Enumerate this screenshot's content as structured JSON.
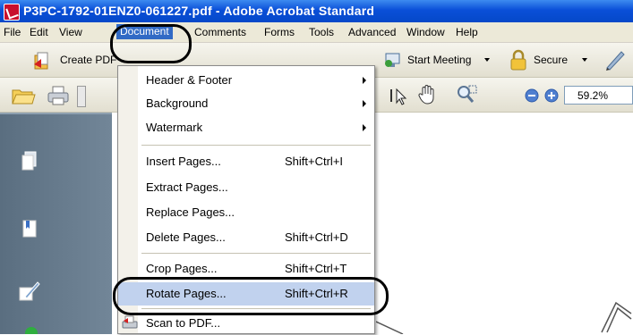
{
  "window": {
    "title": "P3PC-1792-01ENZ0-061227.pdf - Adobe Acrobat Standard"
  },
  "menubar": {
    "items": [
      "File",
      "Edit",
      "View",
      "Document",
      "Comments",
      "Forms",
      "Tools",
      "Advanced",
      "Window",
      "Help"
    ],
    "active": "Document"
  },
  "toolbar": {
    "create_pdf": "Create PDF",
    "start_meeting": "Start Meeting",
    "secure": "Secure",
    "zoom": "59.2%"
  },
  "document_menu": {
    "items": [
      {
        "label": "Header & Footer",
        "shortcut": "",
        "submenu": true
      },
      {
        "label": "Background",
        "shortcut": "",
        "submenu": true
      },
      {
        "label": "Watermark",
        "shortcut": "",
        "submenu": true
      },
      {
        "label": "Insert Pages...",
        "shortcut": "Shift+Ctrl+I"
      },
      {
        "label": "Extract Pages...",
        "shortcut": ""
      },
      {
        "label": "Replace Pages...",
        "shortcut": ""
      },
      {
        "label": "Delete Pages...",
        "shortcut": "Shift+Ctrl+D"
      },
      {
        "label": "Crop Pages...",
        "shortcut": "Shift+Ctrl+T"
      },
      {
        "label": "Rotate Pages...",
        "shortcut": "Shift+Ctrl+R",
        "highlighted": true
      },
      {
        "label": "Scan to PDF...",
        "shortcut": ""
      }
    ]
  },
  "colors": {
    "titlebar": "#0a4fd8",
    "menu_highlight": "#316ac5",
    "item_highlight": "#c1d2ee"
  }
}
